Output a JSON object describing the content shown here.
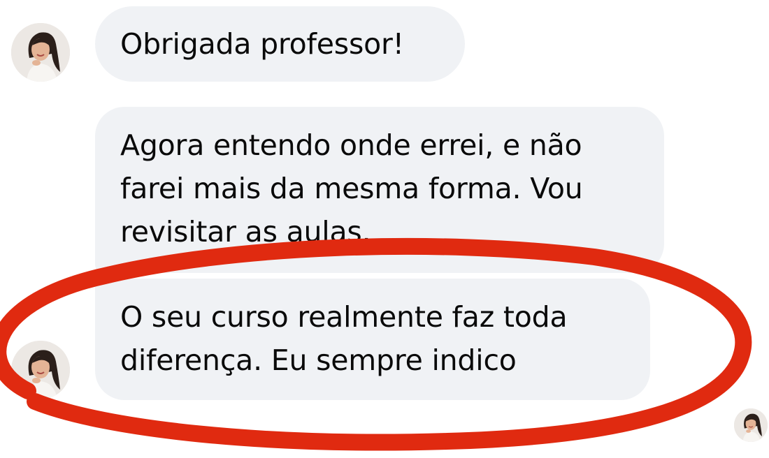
{
  "conversation": {
    "messages": [
      {
        "sender": "student",
        "lines": [
          "Obrigada professor!"
        ]
      },
      {
        "sender": "student",
        "lines": [
          "Agora entendo onde errei, e não",
          "farei mais da mesma forma. Vou",
          "revisitar as aulas."
        ]
      },
      {
        "sender": "student",
        "lines": [
          "O seu curso realmente faz toda",
          "diferença. Eu sempre indico"
        ]
      }
    ],
    "avatar_icon": "woman-portrait-avatar",
    "seen_receipt_icon": "woman-portrait-avatar"
  },
  "annotation": {
    "type": "hand-drawn-ellipse",
    "color": "#e02a10"
  },
  "colors": {
    "bubble_background": "#f0f2f5",
    "text": "#0a0a0a",
    "background": "#ffffff"
  }
}
